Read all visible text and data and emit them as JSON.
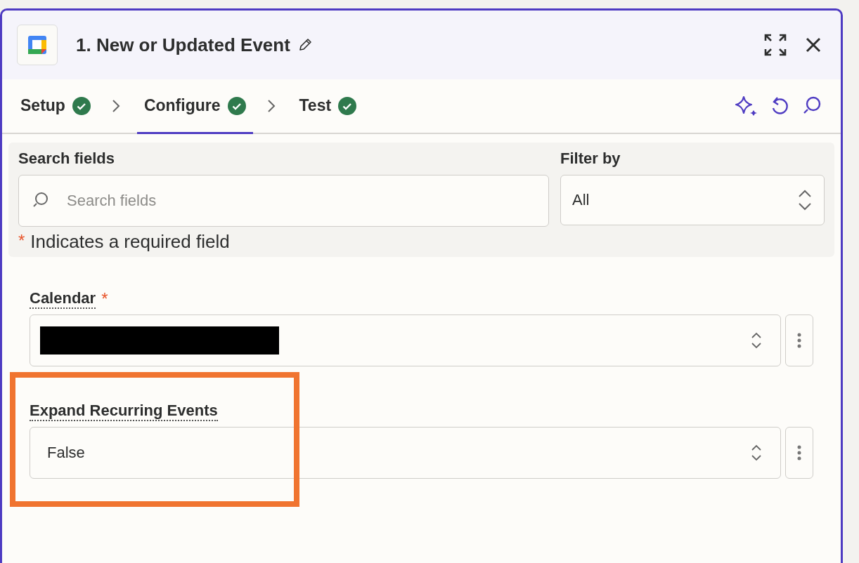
{
  "window": {
    "title": "1. New or Updated Event"
  },
  "steps": [
    {
      "label": "Setup",
      "done": true,
      "selected": false
    },
    {
      "label": "Configure",
      "done": true,
      "selected": true
    },
    {
      "label": "Test",
      "done": true,
      "selected": false
    }
  ],
  "search": {
    "label": "Search fields",
    "placeholder": "Search fields"
  },
  "filter": {
    "label": "Filter by",
    "value": "All"
  },
  "required_note": {
    "mark": "*",
    "text": "Indicates a required field"
  },
  "fields": [
    {
      "label": "Calendar",
      "required": true,
      "redacted": true,
      "highlighted": false
    },
    {
      "label": "Expand Recurring Events",
      "required": false,
      "value": "False",
      "highlighted": true
    }
  ]
}
